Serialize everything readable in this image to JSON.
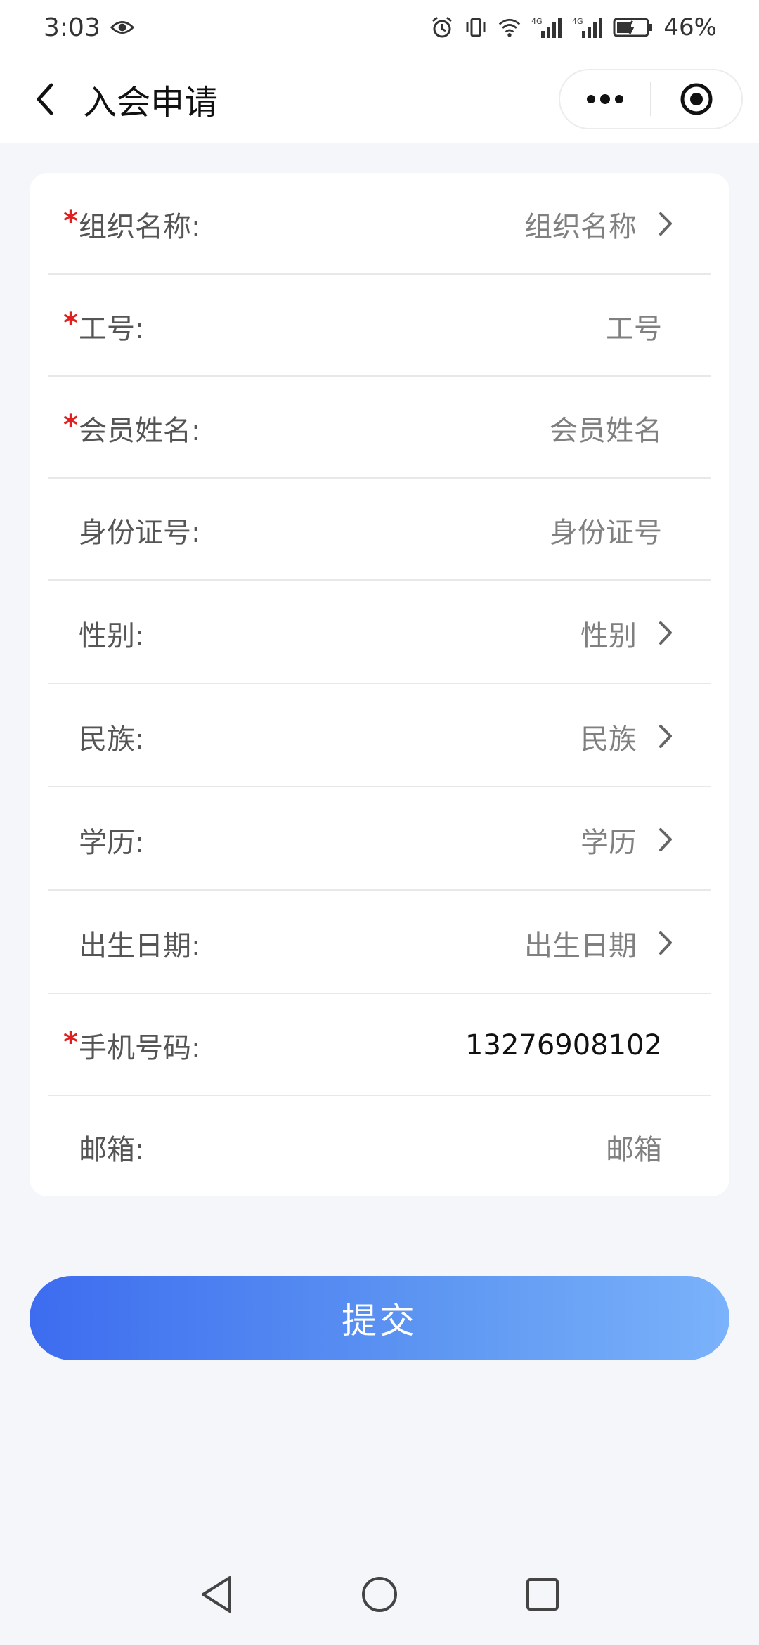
{
  "status_bar": {
    "time": "3:03",
    "battery": "46%",
    "net_1": "4G",
    "net_2": "4G"
  },
  "nav": {
    "title": "入会申请",
    "icons": [
      "back-chevron-icon",
      "more-dots-icon",
      "target-close-icon"
    ]
  },
  "form": {
    "rows": [
      {
        "label": "组织名称:",
        "value": "组织名称",
        "required": true,
        "chevron": true,
        "filled": false
      },
      {
        "label": "工号:",
        "value": "工号",
        "required": true,
        "chevron": false,
        "filled": false
      },
      {
        "label": "会员姓名:",
        "value": "会员姓名",
        "required": true,
        "chevron": false,
        "filled": false
      },
      {
        "label": "身份证号:",
        "value": "身份证号",
        "required": false,
        "chevron": false,
        "filled": false
      },
      {
        "label": "性别:",
        "value": "性别",
        "required": false,
        "chevron": true,
        "filled": false
      },
      {
        "label": "民族:",
        "value": "民族",
        "required": false,
        "chevron": true,
        "filled": false
      },
      {
        "label": "学历:",
        "value": "学历",
        "required": false,
        "chevron": true,
        "filled": false
      },
      {
        "label": "出生日期:",
        "value": "出生日期",
        "required": false,
        "chevron": true,
        "filled": false
      },
      {
        "label": "手机号码:",
        "value": "13276908102",
        "required": true,
        "chevron": false,
        "filled": true
      },
      {
        "label": "邮箱:",
        "value": "邮箱",
        "required": false,
        "chevron": false,
        "filled": false
      }
    ],
    "required_mark": "*"
  },
  "submit": {
    "label": "提交"
  },
  "colors": {
    "accent_start": "#3d6cf0",
    "accent_end": "#7bb2fb",
    "required": "#e02020",
    "background": "#f5f6fa"
  },
  "system_nav": {
    "icons": [
      "back-triangle-icon",
      "home-circle-icon",
      "recents-square-icon"
    ]
  }
}
